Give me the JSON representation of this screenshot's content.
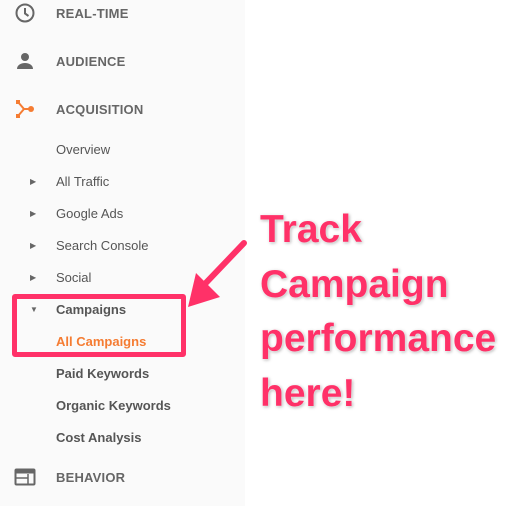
{
  "sidebar": {
    "top_items": [
      {
        "label": "REAL-TIME",
        "icon": "clock-icon"
      },
      {
        "label": "AUDIENCE",
        "icon": "person-icon"
      },
      {
        "label": "ACQUISITION",
        "icon": "acquisition-icon"
      },
      {
        "label": "BEHAVIOR",
        "icon": "behavior-icon"
      }
    ],
    "acquisition_items": [
      {
        "label": "Overview"
      },
      {
        "label": "All Traffic"
      },
      {
        "label": "Google Ads"
      },
      {
        "label": "Search Console"
      },
      {
        "label": "Social"
      },
      {
        "label": "Campaigns"
      },
      {
        "label": "All Campaigns"
      },
      {
        "label": "Paid Keywords"
      },
      {
        "label": "Organic Keywords"
      },
      {
        "label": "Cost Analysis"
      }
    ]
  },
  "annotation": {
    "lines": [
      "Track",
      "Campaign",
      "performance",
      "here!"
    ]
  },
  "colors": {
    "accent": "#f57c32",
    "annotation": "#ff3168",
    "sidebar_bg": "#fafafa"
  }
}
